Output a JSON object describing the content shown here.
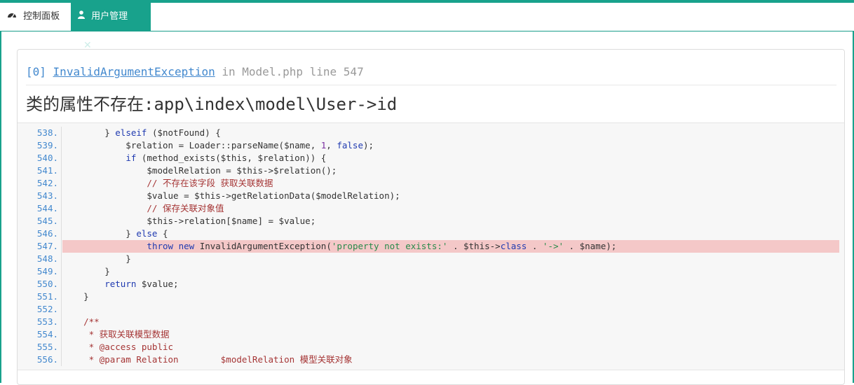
{
  "tabs": [
    {
      "label": "控制面板",
      "icon": "dashboard-icon",
      "active": false
    },
    {
      "label": "用户管理",
      "icon": "user-icon",
      "active": true,
      "close": "✕"
    }
  ],
  "colors": {
    "accent": "#18a28c",
    "link": "#4288ce",
    "highlight": "#f4c8c8"
  },
  "exception": {
    "index": "[0]",
    "class": "InvalidArgumentException",
    "in": "in",
    "file": "Model.php",
    "line_label": "line",
    "line": "547",
    "message": "类的属性不存在:app\\index\\model\\User->id"
  },
  "code": {
    "highlight_line": "547.",
    "lines": [
      {
        "num": "538.",
        "text": "        } elseif ($notFound) {"
      },
      {
        "num": "539.",
        "text": "            $relation = Loader::parseName($name, 1, false);"
      },
      {
        "num": "540.",
        "text": "            if (method_exists($this, $relation)) {"
      },
      {
        "num": "541.",
        "text": "                $modelRelation = $this->$relation();"
      },
      {
        "num": "542.",
        "text": "                // 不存在该字段 获取关联数据"
      },
      {
        "num": "543.",
        "text": "                $value = $this->getRelationData($modelRelation);"
      },
      {
        "num": "544.",
        "text": "                // 保存关联对象值"
      },
      {
        "num": "545.",
        "text": "                $this->relation[$name] = $value;"
      },
      {
        "num": "546.",
        "text": "            } else {"
      },
      {
        "num": "547.",
        "text": "                throw new InvalidArgumentException('property not exists:' . $this->class . '->' . $name);"
      },
      {
        "num": "548.",
        "text": "            }"
      },
      {
        "num": "549.",
        "text": "        }"
      },
      {
        "num": "550.",
        "text": "        return $value;"
      },
      {
        "num": "551.",
        "text": "    }"
      },
      {
        "num": "552.",
        "text": ""
      },
      {
        "num": "553.",
        "text": "    /**"
      },
      {
        "num": "554.",
        "text": "     * 获取关联模型数据"
      },
      {
        "num": "555.",
        "text": "     * @access public"
      },
      {
        "num": "556.",
        "text": "     * @param Relation        $modelRelation 模型关联对象"
      }
    ]
  }
}
